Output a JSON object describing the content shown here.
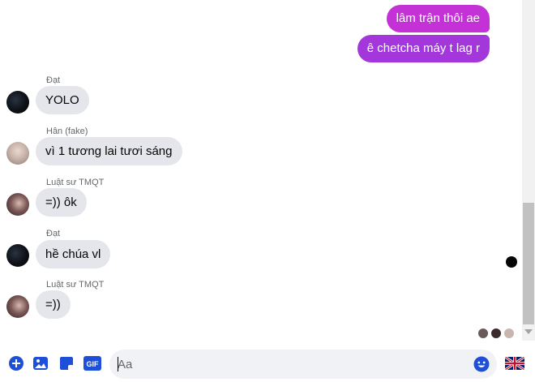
{
  "messages": {
    "outgoing": [
      {
        "text": "lâm trận thôi ae"
      },
      {
        "text": "ê chetcha máy t lag r"
      }
    ],
    "incoming": [
      {
        "sender": "Đạt",
        "text": "YOLO"
      },
      {
        "sender": "Hân (fake)",
        "text": "vì 1 tương lai tươi sáng"
      },
      {
        "sender": "Luật sư TMQT",
        "text": "=)) ôk"
      },
      {
        "sender": "Đạt",
        "text": "hề chúa vl"
      },
      {
        "sender": "Luật sư TMQT",
        "text": "=))"
      }
    ]
  },
  "composer": {
    "placeholder": "Aa",
    "gif_label": "GIF"
  },
  "colors": {
    "accent": "#1d4fd8",
    "outgoing_top": "#c431d7",
    "outgoing_bottom": "#a337dc",
    "incoming_bubble": "#e4e6eb",
    "input_bg": "#f0f2f5"
  },
  "icons": [
    "plus-icon",
    "image-icon",
    "sticker-icon",
    "gif-icon",
    "emoji-icon",
    "uk-flag-icon"
  ]
}
